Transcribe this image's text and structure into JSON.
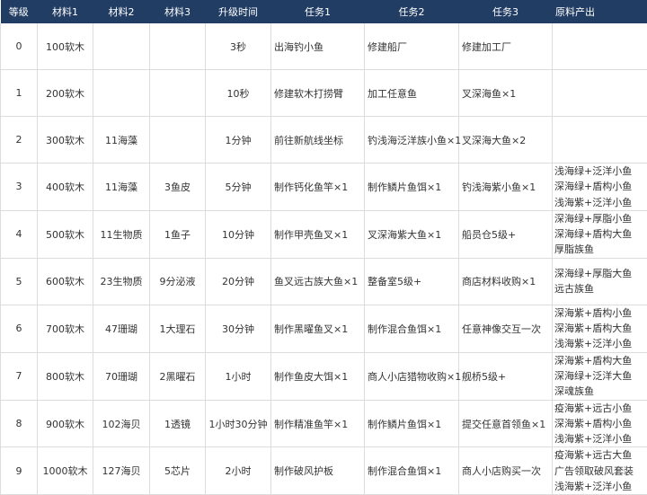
{
  "headers": [
    "等级",
    "材料1",
    "材料2",
    "材料3",
    "升级时间",
    "任务1",
    "任务2",
    "任务3",
    "原料产出"
  ],
  "rows": [
    {
      "level": "0",
      "m1": "100软木",
      "m2": "",
      "m3": "",
      "time": "3秒",
      "t1": "出海钓小鱼",
      "t2": "修建船厂",
      "t3": "修建加工厂",
      "out": []
    },
    {
      "level": "1",
      "m1": "200软木",
      "m2": "",
      "m3": "",
      "time": "10秒",
      "t1": "修建软木打捞臂",
      "t2": "加工任意鱼",
      "t3": "叉深海鱼×1",
      "out": []
    },
    {
      "level": "2",
      "m1": "300软木",
      "m2": "11海藻",
      "m3": "",
      "time": "1分钟",
      "t1": "前往新航线坐标",
      "t2": "钓浅海泛洋族小鱼×1",
      "t3": "叉深海大鱼×2",
      "out": []
    },
    {
      "level": "3",
      "m1": "400软木",
      "m2": "11海藻",
      "m3": "3鱼皮",
      "time": "5分钟",
      "t1": "制作钙化鱼竿×1",
      "t2": "制作鳞片鱼饵×1",
      "t3": "钓浅海紫小鱼×1",
      "out": [
        "浅海绿+泛洋小鱼",
        "深海绿+盾构小鱼",
        "浅海紫+泛洋小鱼"
      ]
    },
    {
      "level": "4",
      "m1": "500软木",
      "m2": "11生物质",
      "m3": "1鱼子",
      "time": "10分钟",
      "t1": "制作甲壳鱼叉×1",
      "t2": "叉深海紫大鱼×1",
      "t3": "船员仓5级+",
      "out": [
        "深海绿+厚脂小鱼",
        "深海绿+盾构大鱼",
        "厚脂族鱼"
      ]
    },
    {
      "level": "5",
      "m1": "600软木",
      "m2": "23生物质",
      "m3": "9分泌液",
      "time": "20分钟",
      "t1": "鱼叉远古族大鱼×1",
      "t2": "整备室5级+",
      "t3": "商店材料收购×1",
      "out": [
        "深海绿+厚脂大鱼",
        "远古族鱼"
      ]
    },
    {
      "level": "6",
      "m1": "700软木",
      "m2": "47珊瑚",
      "m3": "1大理石",
      "time": "30分钟",
      "t1": "制作黑曜鱼叉×1",
      "t2": "制作混合鱼饵×1",
      "t3": "任意神像交互一次",
      "out": [
        "深海紫+盾构小鱼",
        "深海紫+盾构大鱼",
        "浅海紫+泛洋小鱼"
      ]
    },
    {
      "level": "7",
      "m1": "800软木",
      "m2": "70珊瑚",
      "m3": "2黑曜石",
      "time": "1小时",
      "t1": "制作鱼皮大饵×1",
      "t2": "商人小店猎物收购×1",
      "t3": "舰桥5级+",
      "out": [
        "深海紫+盾构大鱼",
        "深海绿+泛洋大鱼",
        "深魂族鱼"
      ]
    },
    {
      "level": "8",
      "m1": "900软木",
      "m2": "102海贝",
      "m3": "1透镜",
      "time": "1小时30分钟",
      "t1": "制作精准鱼竿×1",
      "t2": "制作鳞片鱼饵×1",
      "t3": "提交任意首领鱼×1",
      "out": [
        "疫海紫+远古小鱼",
        "深海紫+盾构小鱼",
        "浅海紫+泛洋小鱼"
      ]
    },
    {
      "level": "9",
      "m1": "1000软木",
      "m2": "127海贝",
      "m3": "5芯片",
      "time": "2小时",
      "t1": "制作破风护板",
      "t2": "制作混合鱼饵×1",
      "t3": "商人小店购买一次",
      "out": [
        "疫海紫+远古大鱼",
        "广告领取破风套装",
        "浅海紫+泛洋小鱼"
      ]
    }
  ]
}
